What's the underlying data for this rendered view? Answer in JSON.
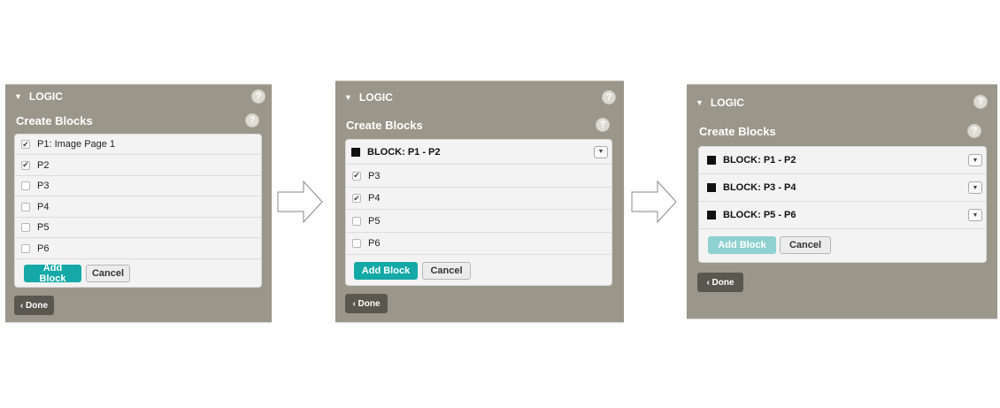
{
  "header_title": "LOGIC",
  "section_title": "Create Blocks",
  "help_glyph": "?",
  "triangle_glyph": "▼",
  "check_glyph": "✔",
  "dropdown_glyph": "▼",
  "add_block_label": "Add Block",
  "cancel_label": "Cancel",
  "done_label": "‹ Done",
  "panel1": {
    "items": [
      {
        "label": "P1: Image Page 1",
        "checked": true
      },
      {
        "label": "P2",
        "checked": true
      },
      {
        "label": "P3",
        "checked": false
      },
      {
        "label": "P4",
        "checked": false
      },
      {
        "label": "P5",
        "checked": false
      },
      {
        "label": "P6",
        "checked": false
      }
    ]
  },
  "panel2": {
    "block": "BLOCK: P1 - P2",
    "items": [
      {
        "label": "P3",
        "checked": true
      },
      {
        "label": "P4",
        "checked": true
      },
      {
        "label": "P5",
        "checked": false
      },
      {
        "label": "P6",
        "checked": false
      }
    ]
  },
  "panel3": {
    "blocks": [
      "BLOCK: P1 - P2",
      "BLOCK: P3 - P4",
      "BLOCK: P5 - P6"
    ]
  },
  "colors": {
    "panel_bg": "#9a978a",
    "teal": "#14a9a7",
    "teal_disabled": "#8fd1d0",
    "done_bg": "#5a574e"
  }
}
